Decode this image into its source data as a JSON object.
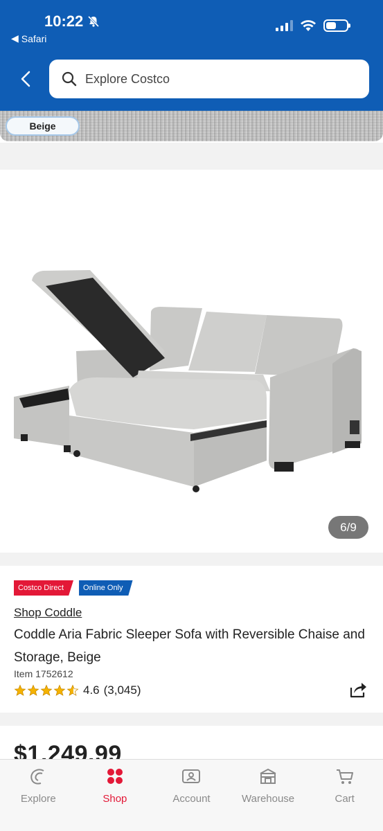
{
  "status_bar": {
    "time": "10:22",
    "back_app": "Safari"
  },
  "header": {
    "search_placeholder": "Explore Costco"
  },
  "swatch": {
    "selected_label": "Beige"
  },
  "gallery": {
    "counter": "6/9",
    "current": 6,
    "total": 9
  },
  "product": {
    "badges": [
      "Costco Direct",
      "Online Only"
    ],
    "brand_link": "Shop Coddle",
    "title": "Coddle Aria Fabric Sleeper Sofa with Reversible Chaise and Storage, Beige",
    "item_number": "Item 1752612",
    "rating_value": "4.6",
    "rating_count": "(3,045)",
    "rating_stars": 4.6
  },
  "price": {
    "amount": "$1,249.99"
  },
  "tabbar": {
    "tabs": [
      {
        "label": "Explore",
        "icon": "explore-icon"
      },
      {
        "label": "Shop",
        "icon": "shop-grid-icon",
        "active": true
      },
      {
        "label": "Account",
        "icon": "account-icon"
      },
      {
        "label": "Warehouse",
        "icon": "warehouse-icon"
      },
      {
        "label": "Cart",
        "icon": "cart-icon"
      }
    ]
  },
  "colors": {
    "brand_blue": "#0f5db5",
    "brand_red": "#e31837"
  }
}
